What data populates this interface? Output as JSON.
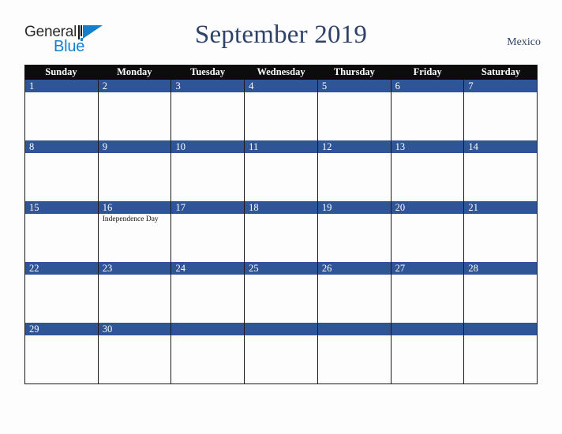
{
  "brand": {
    "word1": "General",
    "word2": "Blue",
    "mark": "triangle-logo"
  },
  "header": {
    "title": "September 2019",
    "country": "Mexico"
  },
  "colors": {
    "date_bar_blue": "#2f5597",
    "header_black": "#0c0c0d",
    "title_navy": "#2f4268",
    "brand_blue": "#1380cf",
    "page_background": "#fdfdfd"
  },
  "calendar": {
    "day_headers": [
      "Sunday",
      "Monday",
      "Tuesday",
      "Wednesday",
      "Thursday",
      "Friday",
      "Saturday"
    ],
    "weeks": [
      [
        {
          "date": "1",
          "event": ""
        },
        {
          "date": "2",
          "event": ""
        },
        {
          "date": "3",
          "event": ""
        },
        {
          "date": "4",
          "event": ""
        },
        {
          "date": "5",
          "event": ""
        },
        {
          "date": "6",
          "event": ""
        },
        {
          "date": "7",
          "event": ""
        }
      ],
      [
        {
          "date": "8",
          "event": ""
        },
        {
          "date": "9",
          "event": ""
        },
        {
          "date": "10",
          "event": ""
        },
        {
          "date": "11",
          "event": ""
        },
        {
          "date": "12",
          "event": ""
        },
        {
          "date": "13",
          "event": ""
        },
        {
          "date": "14",
          "event": ""
        }
      ],
      [
        {
          "date": "15",
          "event": ""
        },
        {
          "date": "16",
          "event": "Independence Day"
        },
        {
          "date": "17",
          "event": ""
        },
        {
          "date": "18",
          "event": ""
        },
        {
          "date": "19",
          "event": ""
        },
        {
          "date": "20",
          "event": ""
        },
        {
          "date": "21",
          "event": ""
        }
      ],
      [
        {
          "date": "22",
          "event": ""
        },
        {
          "date": "23",
          "event": ""
        },
        {
          "date": "24",
          "event": ""
        },
        {
          "date": "25",
          "event": ""
        },
        {
          "date": "26",
          "event": ""
        },
        {
          "date": "27",
          "event": ""
        },
        {
          "date": "28",
          "event": ""
        }
      ],
      [
        {
          "date": "29",
          "event": ""
        },
        {
          "date": "30",
          "event": ""
        },
        {
          "date": "",
          "event": ""
        },
        {
          "date": "",
          "event": ""
        },
        {
          "date": "",
          "event": ""
        },
        {
          "date": "",
          "event": ""
        },
        {
          "date": "",
          "event": ""
        }
      ]
    ]
  }
}
